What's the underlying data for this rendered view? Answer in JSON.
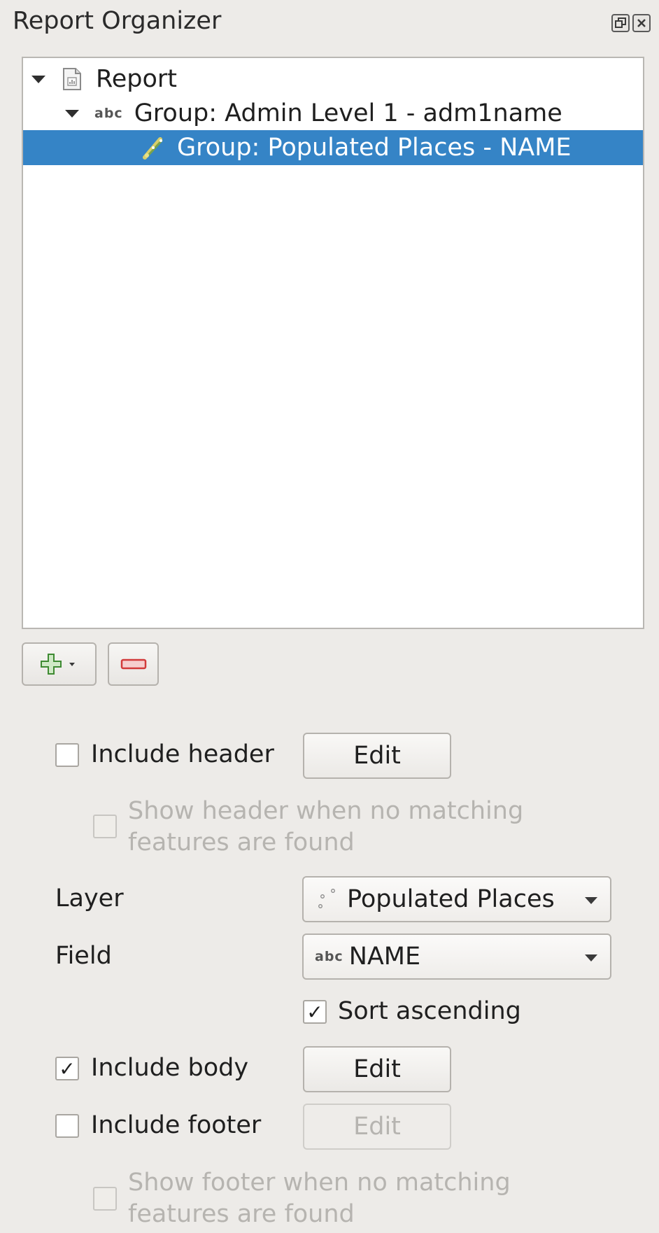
{
  "panel": {
    "title": "Report Organizer"
  },
  "tree": {
    "items": [
      {
        "label": "Report",
        "icon": "report-icon",
        "expanded": true
      },
      {
        "label": "Group: Admin Level 1 - adm1name",
        "icon": "text-field-icon",
        "icon_text": "abc",
        "expanded": true
      },
      {
        "label": "Group: Populated Places - NAME",
        "icon": "point-layer-icon",
        "selected": true
      }
    ]
  },
  "toolbar": {
    "add_icon": "add-section-icon",
    "remove_icon": "remove-section-icon"
  },
  "form": {
    "include_header": {
      "label": "Include header",
      "checked": false,
      "edit_label": "Edit"
    },
    "show_header_empty": {
      "label": "Show header when no matching features are found",
      "checked": false,
      "enabled": false
    },
    "layer": {
      "label": "Layer",
      "value": "Populated Places"
    },
    "field": {
      "label": "Field",
      "value": "NAME",
      "type_text": "abc"
    },
    "sort_ascending": {
      "label": "Sort ascending",
      "checked": true
    },
    "include_body": {
      "label": "Include body",
      "checked": true,
      "edit_label": "Edit"
    },
    "include_footer": {
      "label": "Include footer",
      "checked": false,
      "edit_label": "Edit"
    },
    "show_footer_empty": {
      "label": "Show footer when no matching features are found",
      "checked": false,
      "enabled": false
    }
  },
  "colors": {
    "selection": "#3584c6",
    "background": "#edebe8"
  }
}
